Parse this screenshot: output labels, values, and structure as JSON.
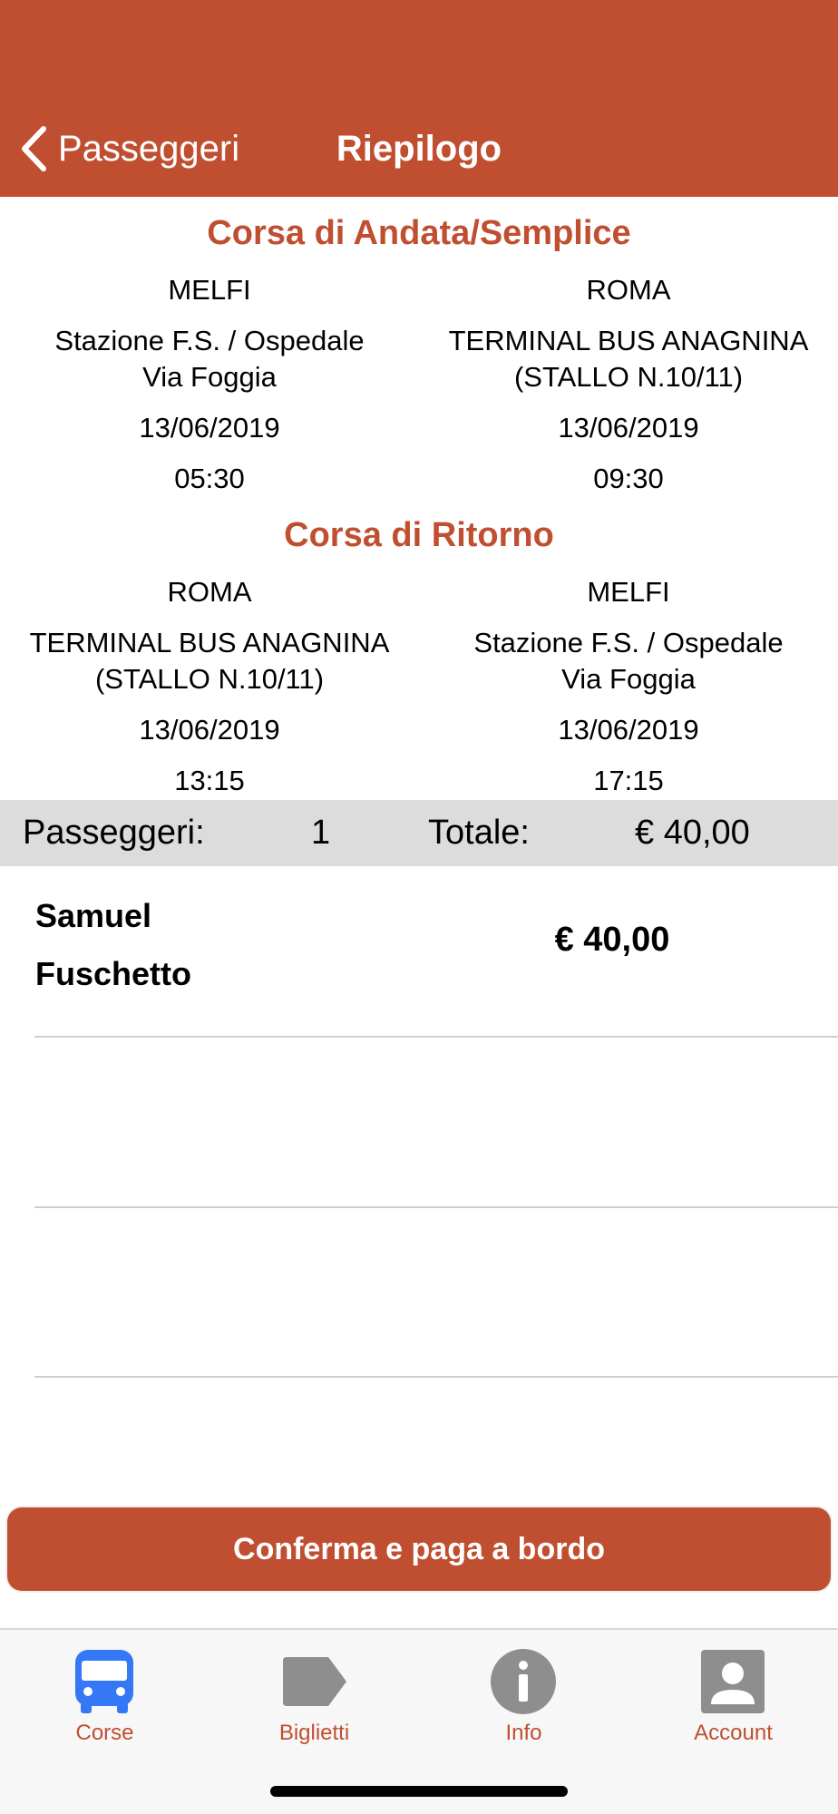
{
  "header": {
    "back_label": "Passeggeri",
    "title": "Riepilogo"
  },
  "outbound": {
    "title": "Corsa di Andata/Semplice",
    "from": {
      "city": "MELFI",
      "stop_line1": "Stazione F.S. / Ospedale",
      "stop_line2": "Via Foggia",
      "date": "13/06/2019",
      "time": "05:30"
    },
    "to": {
      "city": "ROMA",
      "stop_line1": "TERMINAL BUS ANAGNINA",
      "stop_line2": "(STALLO N.10/11)",
      "date": "13/06/2019",
      "time": "09:30"
    }
  },
  "return": {
    "title": "Corsa di Ritorno",
    "from": {
      "city": "ROMA",
      "stop_line1": "TERMINAL BUS ANAGNINA",
      "stop_line2": "(STALLO N.10/11)",
      "date": "13/06/2019",
      "time": "13:15"
    },
    "to": {
      "city": "MELFI",
      "stop_line1": "Stazione F.S. / Ospedale",
      "stop_line2": "Via Foggia",
      "date": "13/06/2019",
      "time": "17:15"
    }
  },
  "summary": {
    "passengers_label": "Passeggeri:",
    "passengers_count": "1",
    "total_label": "Totale:",
    "total_value": "€ 40,00"
  },
  "passengers": [
    {
      "first_name": "Samuel",
      "last_name": "Fuschetto",
      "price": "€ 40,00"
    }
  ],
  "confirm_label": "Conferma e paga a bordo",
  "tabs": [
    {
      "label": "Corse",
      "icon": "bus-icon",
      "active": true
    },
    {
      "label": "Biglietti",
      "icon": "ticket-icon",
      "active": false
    },
    {
      "label": "Info",
      "icon": "info-icon",
      "active": false
    },
    {
      "label": "Account",
      "icon": "account-icon",
      "active": false
    }
  ],
  "colors": {
    "brand": "#C04F31",
    "active_icon": "#3478F6",
    "inactive_icon": "#8E8E8E",
    "summary_bg": "#DCDCDC"
  }
}
